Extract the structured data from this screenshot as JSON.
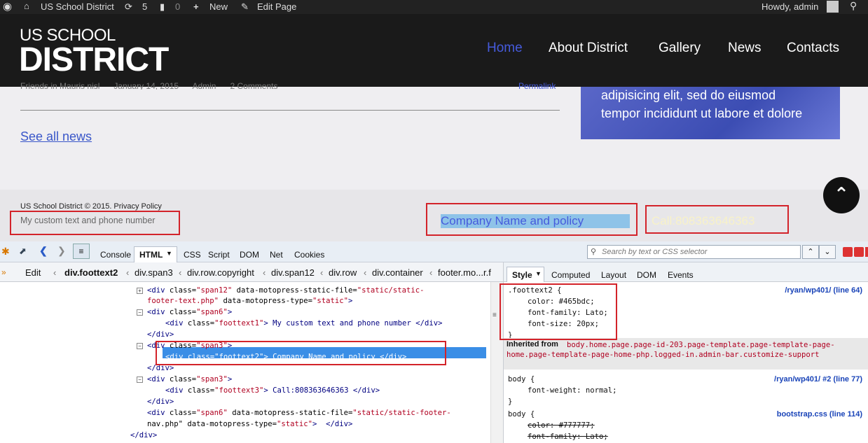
{
  "admin_bar": {
    "site": "US School District",
    "updates": "5",
    "comments": "0",
    "new_label": "New",
    "edit_label": "Edit Page",
    "howdy": "Howdy, admin"
  },
  "header": {
    "logo_top": "US SCHOOL",
    "logo_bottom": "DISTRICT",
    "nav": [
      "Home",
      "About District",
      "Gallery",
      "News",
      "Contacts"
    ],
    "active_color": "#465bdc"
  },
  "content": {
    "meta_partial": "Friends in Mauris nisl      January 14, 2015      Admin      2 Comments",
    "see_all_news": "See all news",
    "permalink": "Permalink",
    "promo_line1": "adipisicing elit, sed do eiusmod",
    "promo_line2": "tempor incididunt ut labore et dolore"
  },
  "footer": {
    "copyright": "US School District © 2015. Privacy Policy",
    "custom_text": "My custom text and phone number",
    "company": "Company Name and policy",
    "call": "Call:808363646363"
  },
  "firebug": {
    "tabs": [
      "Console",
      "HTML",
      "CSS",
      "Script",
      "DOM",
      "Net",
      "Cookies"
    ],
    "active_tab": "HTML",
    "search_placeholder": "Search by text or CSS selector",
    "edit": "Edit",
    "breadcrumbs": [
      "div.foottext2",
      "div.span3",
      "div.row.copyright",
      "div.span12",
      "div.row",
      "div.container",
      "footer.mo...r.f"
    ],
    "side_tabs": [
      "Style",
      "Computed",
      "Layout",
      "DOM",
      "Events"
    ],
    "html_lines": [
      {
        "t": "<div",
        "a": " class=",
        "v": "\"span12\"",
        "a2": " data-motopress-static-file=",
        "v2": "\"static/static-",
        "e": ""
      },
      {
        "t": "",
        "a": "",
        "v": "footer-text.php\"",
        "a2": " data-motopress-type=",
        "v2": "\"static\"",
        "e": ">"
      },
      {
        "t": "<div",
        "a": " class=",
        "v": "\"span6\"",
        "a2": "",
        "v2": "",
        "e": ">"
      },
      {
        "t": "<div",
        "a": " class=",
        "v": "\"foottext1\"",
        "a2": "",
        "v2": "",
        "e": "> My custom text and phone number </div>"
      },
      {
        "t": "</div>",
        "a": "",
        "v": "",
        "a2": "",
        "v2": "",
        "e": ""
      },
      {
        "t": "<div",
        "a": " class=",
        "v": "\"span3\"",
        "a2": "",
        "v2": "",
        "e": ">"
      },
      {
        "t": "<div",
        "a": " class=",
        "v": "\"foottext2\"",
        "a2": "",
        "v2": "",
        "e": "> Company Name and policy </div>"
      },
      {
        "t": "</div>",
        "a": "",
        "v": "",
        "a2": "",
        "v2": "",
        "e": ""
      },
      {
        "t": "<div",
        "a": " class=",
        "v": "\"span3\"",
        "a2": "",
        "v2": "",
        "e": ">"
      },
      {
        "t": "<div",
        "a": " class=",
        "v": "\"foottext3\"",
        "a2": "",
        "v2": "",
        "e": "> Call:808363646363 </div>"
      },
      {
        "t": "</div>",
        "a": "",
        "v": "",
        "a2": "",
        "v2": "",
        "e": ""
      },
      {
        "t": "<div",
        "a": " class=",
        "v": "\"span6\"",
        "a2": " data-motopress-static-file=",
        "v2": "\"static/static-footer-",
        "e": ""
      },
      {
        "t": "",
        "a": "nav.php\"",
        "v": "",
        "a2": " data-motopress-type=",
        "v2": "\"static\"",
        "e": ">  </div>"
      },
      {
        "t": "</div>",
        "a": "",
        "v": "",
        "a2": "",
        "v2": "",
        "e": ""
      },
      {
        "t": "</div>",
        "a": "",
        "v": "",
        "a2": "",
        "v2": "",
        "e": ""
      }
    ],
    "rule1_selector": ".foottext2 {",
    "rule1_props": [
      "color: #465bdc;",
      "font-family: Lato;",
      "font-size: 20px;"
    ],
    "rule1_close": "}",
    "rule1_src": "/ryan/wp401/ (line 64)",
    "inherited_label": "Inherited from",
    "inherited_from": "body.home.page.page-id-203.page-template.page-template-page-home.page-template-page-home-php.logged-in.admin-bar.customize-support",
    "rule2_selector": "body {",
    "rule2_prop": "font-weight: normal;",
    "rule2_close": "}",
    "rule2_src": "/ryan/wp401/ #2 (line 77)",
    "rule3_selector": "body {",
    "rule3_props": [
      "color: #777777;",
      "font-family: Lato;"
    ],
    "rule3_src": "bootstrap.css (line 114)"
  }
}
